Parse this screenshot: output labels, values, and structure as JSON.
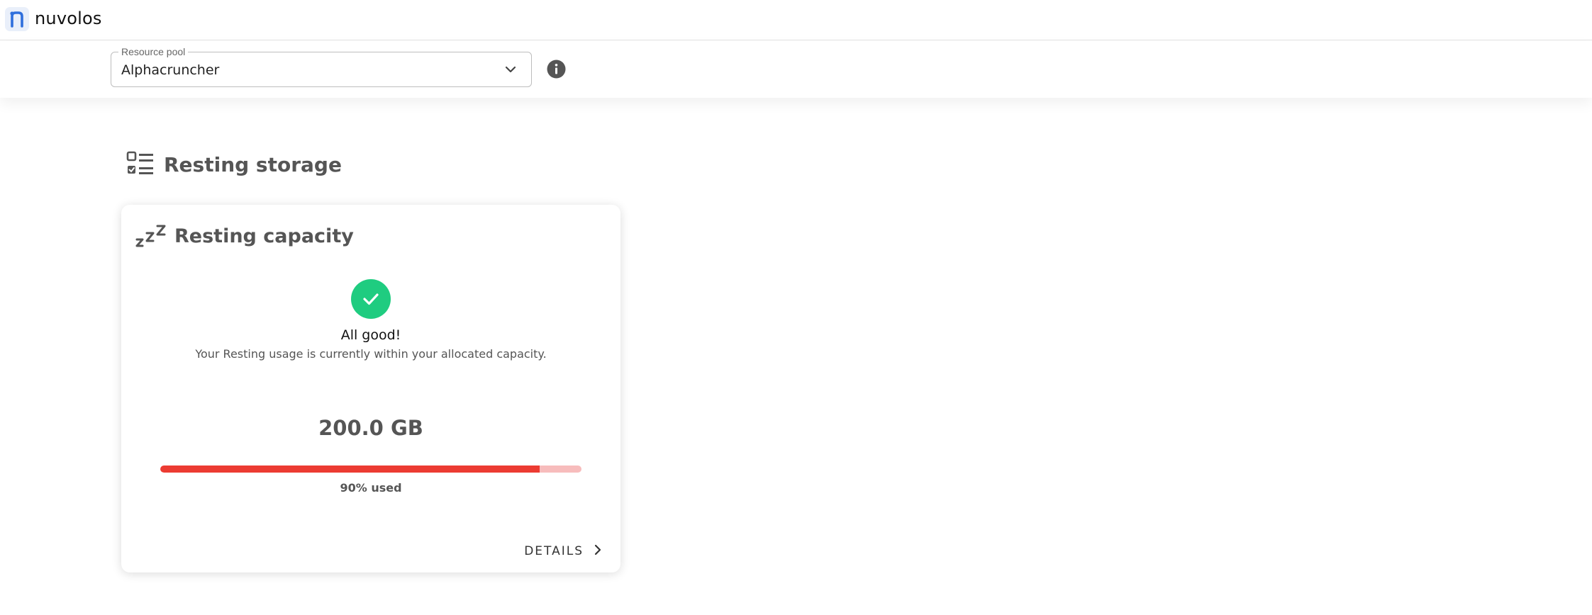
{
  "app": {
    "brand": "nuvolos",
    "logo_icon": "nuvolos-logo-icon",
    "accent_color": "#2f6fdc"
  },
  "resource_pool": {
    "label": "Resource pool",
    "value": "Alphacruncher",
    "dropdown_icon": "chevron-down-icon",
    "info_icon": "info-icon"
  },
  "section": {
    "title": "Resting storage",
    "icon": "checklist-icon"
  },
  "card": {
    "icon": "zzz-icon",
    "title": "Resting capacity",
    "status_icon": "check-circle-icon",
    "status_color": "#1fcc80",
    "status_title": "All good!",
    "status_text": "Your Resting usage is currently within your allocated capacity.",
    "amount": "200.0 GB",
    "usage_percent": 90,
    "usage_label": "90% used",
    "bar_color": "#ec3b32",
    "bar_track_color": "#f7bcbc",
    "details_label": "DETAILS",
    "details_icon": "chevron-right-icon"
  }
}
